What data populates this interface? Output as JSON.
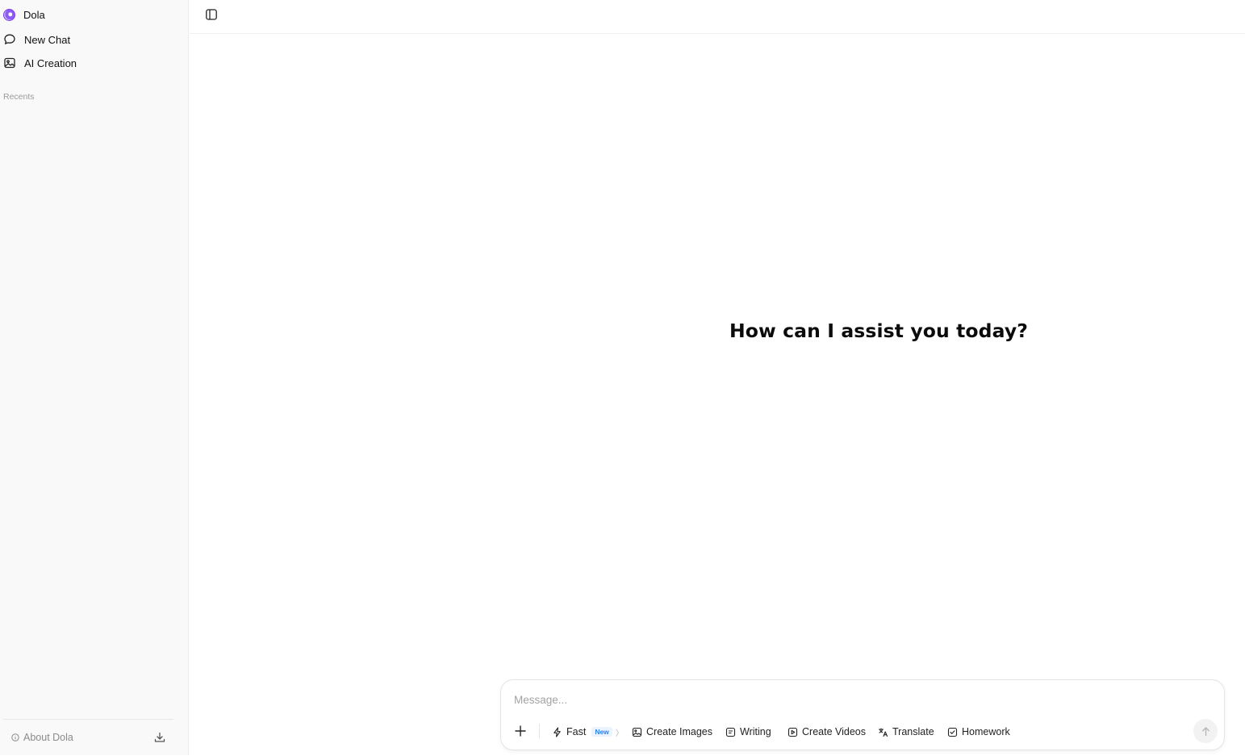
{
  "sidebar": {
    "brand": "Dola",
    "items": [
      {
        "label": "New Chat",
        "icon": "chat-bubble-icon"
      },
      {
        "label": "AI Creation",
        "icon": "image-icon"
      }
    ],
    "recents_label": "Recents",
    "footer": {
      "about_label": "About Dola",
      "download_icon": "download-icon"
    }
  },
  "main": {
    "greeting": "How can I assist you today?"
  },
  "composer": {
    "placeholder": "Message...",
    "mode": {
      "label": "Fast",
      "badge": "New"
    },
    "tools": [
      {
        "label": "Create Images",
        "icon": "image-icon"
      },
      {
        "label": "Writing",
        "icon": "document-icon"
      },
      {
        "label": "Create Videos",
        "icon": "video-icon"
      },
      {
        "label": "Translate",
        "icon": "translate-icon"
      },
      {
        "label": "Homework",
        "icon": "homework-icon"
      }
    ]
  },
  "colors": {
    "accent": "#2f80ed",
    "sidebar_bg": "#f9f9f9",
    "brand_purple": "#7c3aed"
  }
}
